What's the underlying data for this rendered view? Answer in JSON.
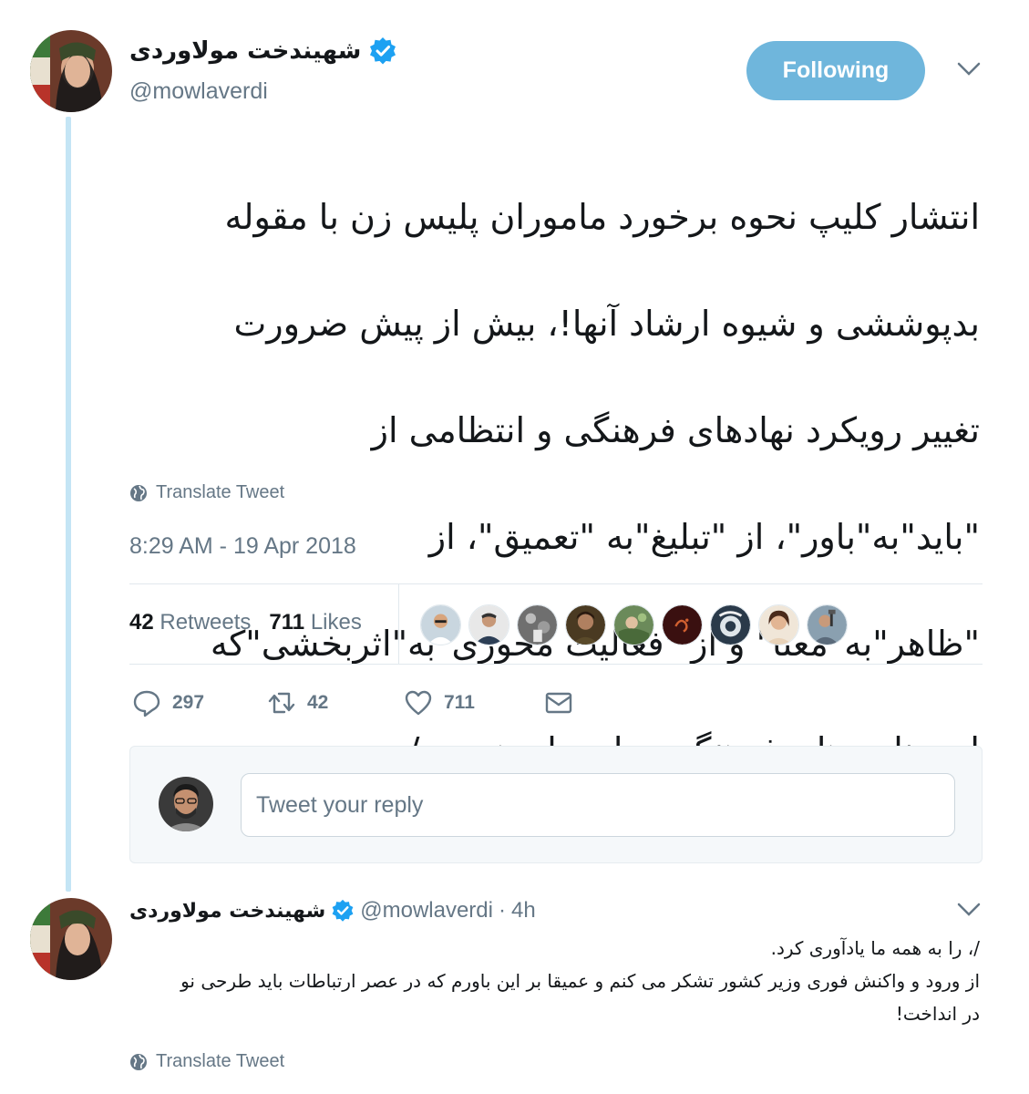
{
  "tweet": {
    "display_name": "شهیندخت مولاوردی",
    "handle": "@mowlaverdi",
    "follow_label": "Following",
    "text_lines": [
      "انتشار کلیپ نحوه برخورد ماموران پلیس زن با مقوله",
      "بدپوششی و شیوه ارشاد آنها!، بیش از پیش ضرورت",
      "تغییر رویکرد نهادهای فرهنگی و انتظامی از",
      "\"باید\"به\"باور\"، از \"تبلیغ\"به \"تعمیق\"، از",
      "\"ظاهر\"به\"معنا\" و از \"فعالیت محوری\"به\"اثربخشی\"که",
      "از برنامه های فرهنگی دولت یازدهم بود/"
    ],
    "translate_label": "Translate Tweet",
    "timestamp": "8:29 AM - 19 Apr 2018",
    "retweets_count": "42",
    "retweets_label": "Retweets",
    "likes_count": "711",
    "likes_label": "Likes",
    "actions": {
      "reply_count": "297",
      "retweet_count": "42",
      "like_count": "711"
    }
  },
  "reply_box": {
    "placeholder": "Tweet your reply"
  },
  "reply_tweet": {
    "display_name": "شهیندخت مولاوردی",
    "handle": "@mowlaverdi",
    "separator": "·",
    "time": "4h",
    "line1": "/، را به همه ما یادآوری کرد.",
    "line2": "از ورود و واکنش فوری وزیر کشور تشکر می کنم و عمیقا بر این باورم که در عصر ارتباطات باید طرحی نو",
    "line3": "در انداخت!",
    "translate_label": "Translate Tweet"
  },
  "colors": {
    "accent": "#1da1f2",
    "follow_button": "#6fb6dc",
    "thread_line": "#c4e5f5",
    "muted_text": "#657786"
  },
  "icons": [
    "verified-badge-icon",
    "chevron-down-icon",
    "globe-icon",
    "reply-icon",
    "retweet-icon",
    "heart-icon",
    "envelope-icon"
  ]
}
